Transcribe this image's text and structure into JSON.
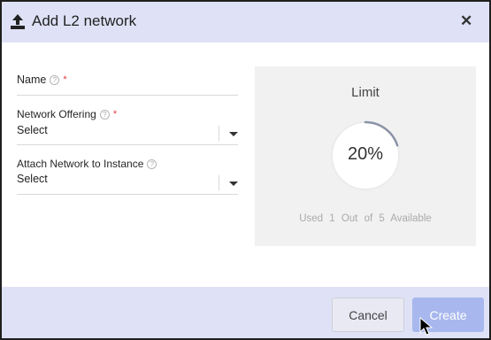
{
  "dialog": {
    "title": "Add L2 network",
    "close_label": "✕",
    "upload_icon": "upload-icon"
  },
  "form": {
    "name": {
      "label": "Name",
      "help": "?",
      "required": "*",
      "value": ""
    },
    "network_offering": {
      "label": "Network Offering",
      "help": "?",
      "required": "*",
      "value": "Select"
    },
    "attach_instance": {
      "label": "Attach Network to Instance",
      "help": "?",
      "value": "Select"
    }
  },
  "limit": {
    "title": "Limit",
    "percent_text": "20%",
    "percent": 0.2,
    "footer": "Used 1 Out of 5 Available"
  },
  "buttons": {
    "cancel": "Cancel",
    "create": "Create"
  },
  "colors": {
    "header_bg": "#dfe2f6",
    "create_bg": "#a8b8ee",
    "required": "#e23a3a",
    "gauge_arc": "#8a93a6"
  }
}
